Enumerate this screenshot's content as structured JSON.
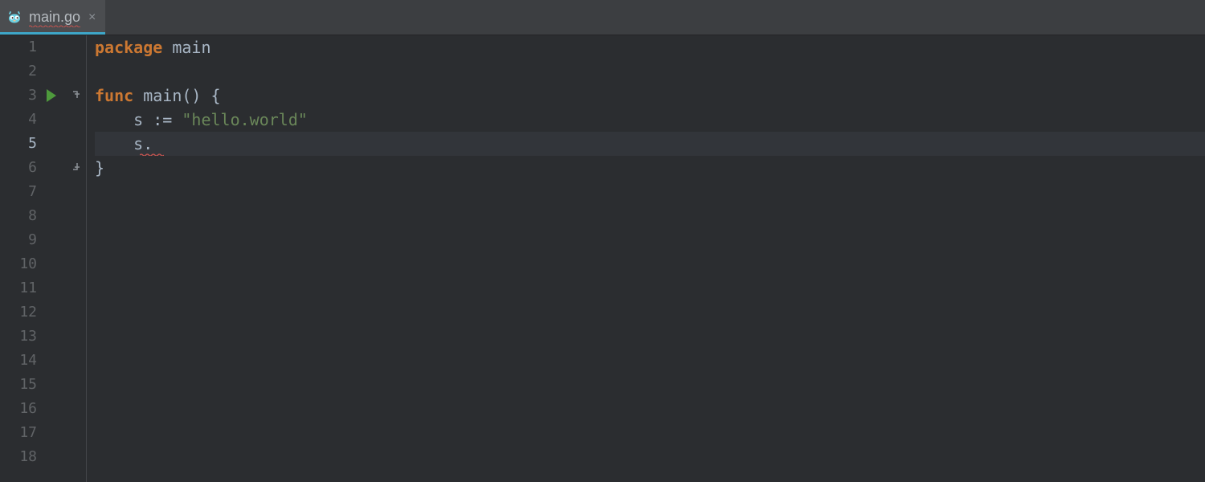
{
  "tab": {
    "filename": "main.go",
    "has_error": true,
    "active": true
  },
  "editor": {
    "total_lines": 18,
    "current_line": 5,
    "run_gutter_line": 3,
    "fold_open_line": 3,
    "fold_close_line": 6,
    "code": {
      "line1": {
        "kw_package": "package",
        "pkg_name": "main"
      },
      "line3": {
        "kw_func": "func",
        "fn_name": "main",
        "after": "() {"
      },
      "line4": {
        "indent": "    ",
        "var": "s",
        "assign": " := ",
        "string": "\"hello.world\""
      },
      "line5": {
        "indent": "    ",
        "var": "s",
        "dot": ".",
        "error_tail": ""
      },
      "line6": {
        "brace": "}"
      }
    }
  },
  "colors": {
    "accent": "#3ea7c9",
    "run_triangle": "#4e9a3c",
    "error": "#c75450"
  }
}
